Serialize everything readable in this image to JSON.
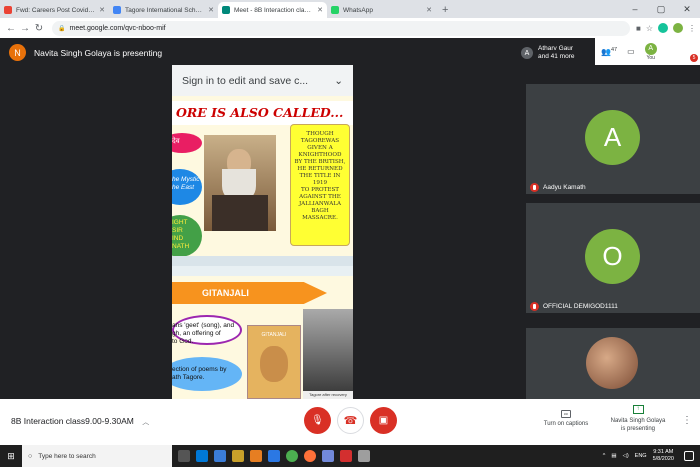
{
  "browser": {
    "tabs": [
      {
        "title": "Fwd: Careers Post Covid 19 - Tag",
        "color": "#ea4335"
      },
      {
        "title": "Tagore International School - Cal",
        "color": "#4285f4"
      },
      {
        "title": "Meet - 8B Interaction class9",
        "color": "#00897b"
      },
      {
        "title": "WhatsApp",
        "color": "#25d366"
      }
    ],
    "url": "meet.google.com/qvc-nboo-mif"
  },
  "meet": {
    "presenter_avatar": "N",
    "presenter_text": "Navita Singh Golaya is presenting",
    "atharv_avatar": "A",
    "atharv_line1": "Atharv Gaur",
    "atharv_line2": "and 41 more",
    "people_count": "47",
    "you_avatar": "A",
    "you_label": "You",
    "you_badge": "5",
    "participants": [
      {
        "initial": "A",
        "name": "Aadyu Kamath"
      },
      {
        "initial": "O",
        "name": "OFFICIAL DEMIGOD1111"
      }
    ]
  },
  "slide": {
    "sign_in": "Sign in to edit and save c...",
    "title": "ORE IS ALSO CALLED...",
    "scroll_lines": [
      "THOUGH",
      "TAGOREWAS",
      "GIVEN A",
      "KNIGHTHOOD",
      "BY THE BRITISH,",
      "HE RETURNED",
      "THE TITLE IN 1919",
      "TO PROTEST",
      "AGAINST THE",
      "JALLIANWALA",
      "BAGH",
      "MASSACRE."
    ],
    "left_text_1": "देव",
    "left_text_2": "he Mystic",
    "left_text_3": "he East",
    "left_text_4": "IGHT",
    "left_text_5": "SIR",
    "left_text_6": "IND",
    "left_text_7": "NATH",
    "gitanjali": "GITANJALI",
    "gitanjali_frame": "GITANJALI",
    "bottom_1": "ans 'geet' (song), and",
    "bottom_2": "gh, an offering of",
    "bottom_3": "to God.",
    "bottom_4": "ection of poems by",
    "bottom_5": "ath Tagore.",
    "photo_caption": "Tagore after recovery"
  },
  "controls": {
    "meeting_title": "8B Interaction class9.00-9.30AM",
    "captions_label": "Turn on captions",
    "presenting_line1": "Navita Singh Golaya",
    "presenting_line2": "is presenting"
  },
  "taskbar": {
    "search_placeholder": "Type here to search",
    "lang": "ENG",
    "time": "9:31 AM",
    "date": "5/8/2020"
  }
}
